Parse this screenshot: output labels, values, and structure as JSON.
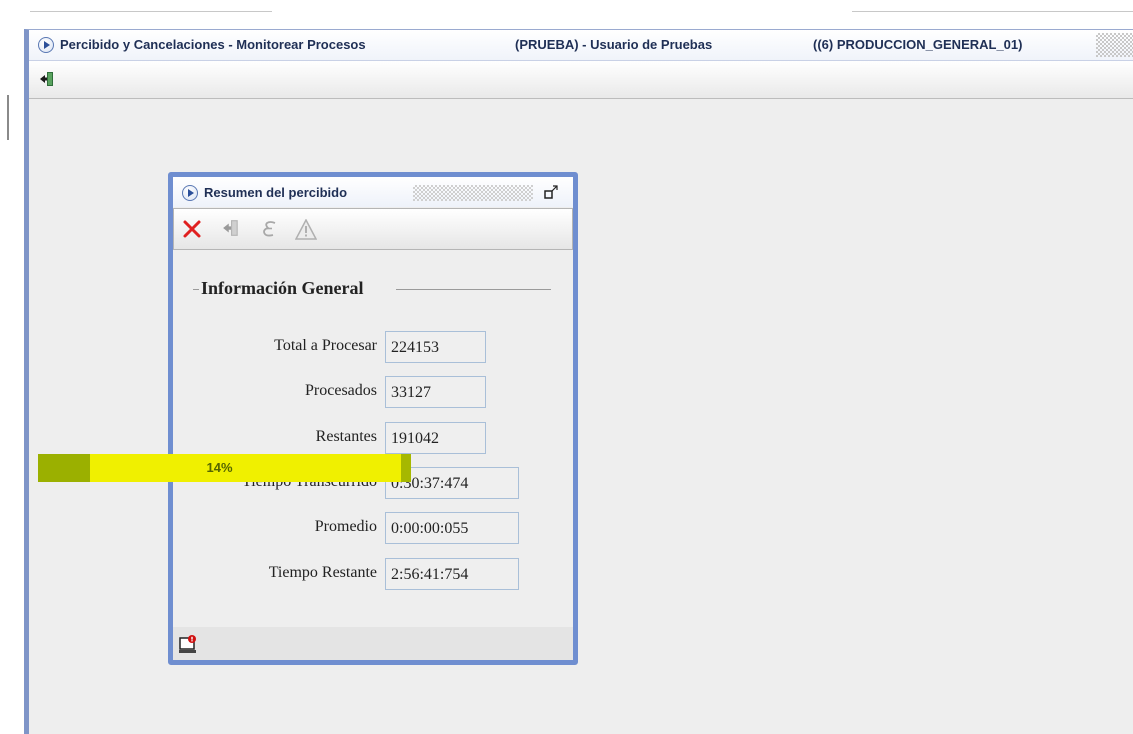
{
  "window": {
    "module_title": "Percibido y Cancelaciones - Monitorear Procesos",
    "user_info": "(PRUEBA) - Usuario de Pruebas",
    "environment": "((6) PRODUCCION_GENERAL_01)"
  },
  "dialog": {
    "title": "Resumen del percibido",
    "section_title": "Información General",
    "fields": [
      {
        "label": "Total a Procesar",
        "value": "224153"
      },
      {
        "label": "Procesados",
        "value": "33127"
      },
      {
        "label": "Restantes",
        "value": "191042"
      },
      {
        "label": "Tiempo Transcurrido",
        "value": "0:30:37:474"
      },
      {
        "label": "Promedio",
        "value": "0:00:00:055"
      },
      {
        "label": "Tiempo Restante",
        "value": "2:56:41:754"
      }
    ],
    "progress": {
      "percent": 14,
      "label": "14%"
    }
  },
  "icons": {
    "main_exit": "exit-door-icon",
    "dialog_title": "play-circle-icon",
    "restore": "restore-window-icon",
    "cancel": "close-x-icon",
    "exit": "exit-door-icon",
    "formula": "epsilon-icon",
    "warning": "warning-triangle-icon",
    "status": "computer-alert-icon"
  },
  "colors": {
    "frame_border": "#6f8ed0",
    "progress_bg": "#f0f000",
    "progress_fill": "#9bb000",
    "cancel_red": "#e02020"
  }
}
